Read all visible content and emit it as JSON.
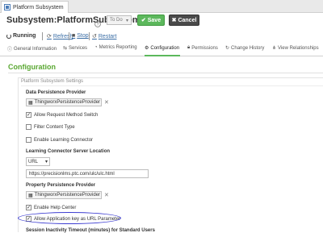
{
  "window": {
    "tab_label": "Platform Subsystem",
    "title": "Subsystem:PlatformSubsystem",
    "state_select": "To Do",
    "save_label": "Save",
    "cancel_label": "Cancel"
  },
  "status": {
    "running": "Running",
    "refresh": "Refresh",
    "stop": "Stop",
    "restart": "Restart"
  },
  "nav_tabs": [
    {
      "label": "General Information",
      "icon": "info-icon"
    },
    {
      "label": "Services",
      "icon": "services-icon"
    },
    {
      "label": "Metrics Reporting",
      "icon": "metrics-icon"
    },
    {
      "label": "Configuration",
      "icon": "configuration-icon",
      "active": true
    },
    {
      "label": "Permissions",
      "icon": "lock-icon"
    },
    {
      "label": "Change History",
      "icon": "history-icon"
    },
    {
      "label": "View Relationships",
      "icon": "relationships-icon"
    }
  ],
  "config": {
    "heading": "Configuration",
    "panel_title": "Platform Subsystem Settings",
    "data_persistence_label": "Data Persistence Provider",
    "data_persistence_value": "ThingworxPersistenceProvider",
    "allow_request_method_switch": "Allow Request Method Switch",
    "filter_content_type": "Filter Content Type",
    "enable_learning_connector": "Enable Learning Connector",
    "learning_connector_location_label": "Learning Connector Server Location",
    "learning_connector_type": "URL",
    "learning_connector_url": "https://precisionlms.ptc.com/ulc/ulc.html",
    "property_persistence_label": "Property Persistence Provider",
    "property_persistence_value": "ThingworxPersistenceProvider",
    "enable_help_center": "Enable Help Center",
    "allow_app_key_url": "Allow Application key as URL Parameter",
    "cut_label": "Session Inactivity Timeout (minutes) for Standard Users"
  },
  "checkbox_states": {
    "allow_request_method_switch": true,
    "filter_content_type": false,
    "enable_learning_connector": false,
    "enable_help_center": true,
    "allow_app_key_url": true
  },
  "colors": {
    "accent_green": "#5aa832",
    "save_button": "#5cb85c",
    "cancel_button": "#4a4a4a",
    "link": "#3b6ea5",
    "annotation": "#3d3dd1"
  }
}
